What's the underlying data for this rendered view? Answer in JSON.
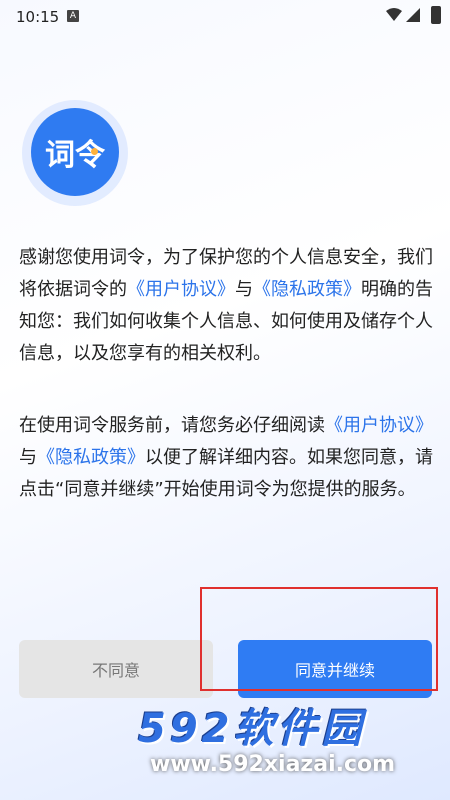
{
  "status_bar": {
    "time": "10:15",
    "notification_icon": "A",
    "icons": [
      "wifi-icon",
      "signal-icon",
      "battery-icon"
    ]
  },
  "logo": {
    "text": "词令",
    "accent_color": "#ffb13b",
    "brand_color": "#2f7bf1"
  },
  "paragraph1": {
    "a": "感谢您使用词令，为了保护您的个人信息安全，我们将依据词令的",
    "link1": "《用户协议》",
    "b": "与",
    "link2": "《隐私政策》",
    "c": "明确的告知您：我们如何收集个人信息、如何使用及储存个人信息，以及您享有的相关权利。"
  },
  "paragraph2": {
    "a": "在使用词令服务前，请您务必仔细阅读",
    "link1": "《用户协议》",
    "b": "与",
    "link2": "《隐私政策》",
    "c": "以便了解详细内容。如果您同意，请点击“同意并继续”开始使用词令为您提供的服务。"
  },
  "buttons": {
    "disagree": "不同意",
    "agree": "同意并继续"
  },
  "watermark": {
    "title": "592软件园",
    "url": "www.592xiazai.com"
  },
  "colors": {
    "link": "#2c74ea",
    "agree_bg": "#2f7cf3",
    "highlight": "#e0302e"
  }
}
